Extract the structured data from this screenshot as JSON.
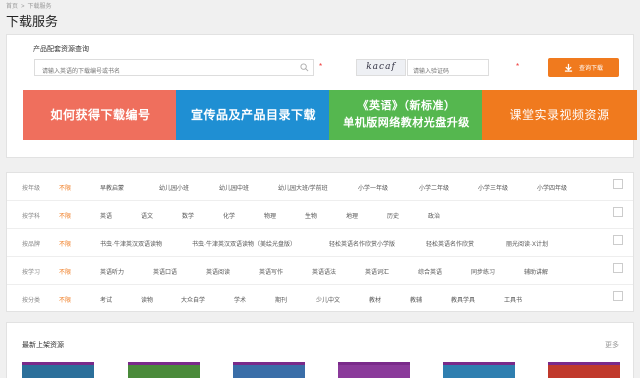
{
  "breadcrumb": {
    "home": "首页",
    "separator": ">",
    "current": "下载服务"
  },
  "page_title": "下载服务",
  "search": {
    "title": "产品配套资源查询",
    "placeholder": "请输入英语的下载编号或书名",
    "required_mark": "*",
    "captcha_text": "kacaf",
    "captcha_placeholder": "请输入验证码",
    "button_label": "查询下载"
  },
  "banners": [
    {
      "line1": "如何获得下载编号",
      "line2": "",
      "color": "#ef6f5d"
    },
    {
      "line1": "宣传品及产品目录下载",
      "line2": "",
      "color": "#1f8fd3"
    },
    {
      "line1": "《英语》（新标准）",
      "line2": "单机版网络教材光盘升级",
      "color": "#55b74f"
    },
    {
      "line1": "课堂实录视频资源",
      "line2": "",
      "color": "#f07a1e"
    }
  ],
  "filters": [
    {
      "label": "按年级",
      "all": "不限",
      "options": [
        "早教启蒙",
        "幼儿园小班",
        "幼儿园中班",
        "幼儿园大班/学前班",
        "小学一年级",
        "小学二年级",
        "小学三年级",
        "小学四年级"
      ]
    },
    {
      "label": "按学科",
      "all": "不限",
      "options": [
        "英语",
        "语文",
        "数学",
        "化学",
        "物理",
        "生物",
        "地理",
        "历史",
        "政治"
      ]
    },
    {
      "label": "按品牌",
      "all": "不限",
      "options": [
        "书虫·牛津英汉双语读物",
        "书虫·牛津英汉双语读物（美绘光盘版）",
        "轻松英语名作欣赏小学版",
        "轻松英语名作欣赏",
        "丽光阅读·X计划"
      ]
    },
    {
      "label": "按学习",
      "all": "不限",
      "options": [
        "英语听力",
        "英语口语",
        "英语阅读",
        "英语写作",
        "英语语法",
        "英语词汇",
        "综合英语",
        "同步练习",
        "辅助讲解"
      ]
    },
    {
      "label": "按分类",
      "all": "不限",
      "options": [
        "考试",
        "读物",
        "大众自学",
        "学术",
        "期刊",
        "少儿中文",
        "教材",
        "教辅",
        "教具学具",
        "工具书"
      ]
    }
  ],
  "new_resources": {
    "title": "最新上架资源",
    "more": "更多",
    "thumb_colors": [
      "#2b6f9a",
      "#4a8a3a",
      "#3a6ea8",
      "#8a3a9a",
      "#2f7fb0",
      "#c0392b"
    ]
  }
}
